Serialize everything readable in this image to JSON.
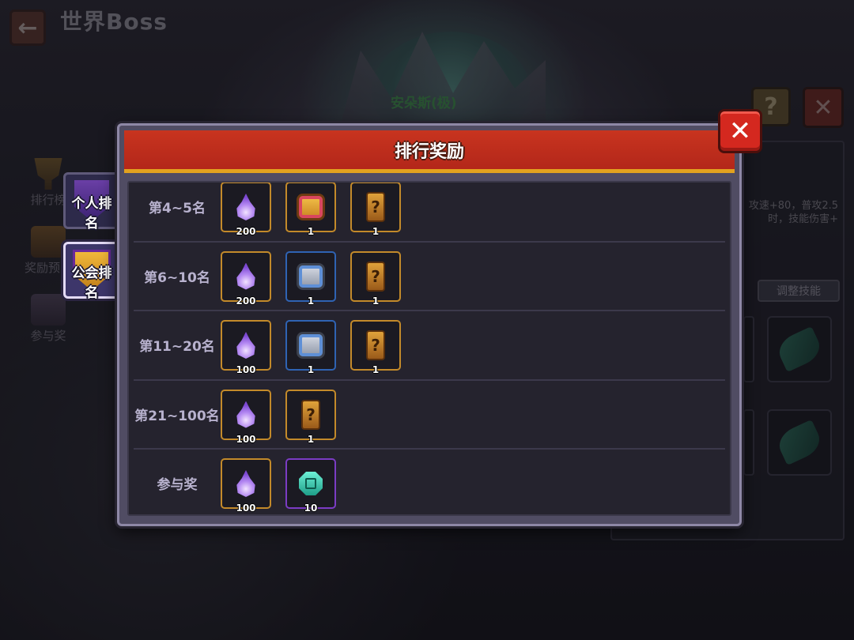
{
  "topbar": {
    "back_icon": "←",
    "title": "世界Boss"
  },
  "boss": {
    "name": "安朵斯(极)"
  },
  "top_right": {
    "help_icon": "?",
    "close_icon": "✕"
  },
  "background_sidebar": {
    "items": [
      {
        "label": "排行榜",
        "icon": "trophy-icon"
      },
      {
        "label": "奖励预览",
        "icon": "chest-icon"
      },
      {
        "label": "参与奖",
        "icon": "bag-icon"
      }
    ]
  },
  "background_panel": {
    "description": "攻速+80，普攻2.5时，技能伤害+",
    "skill_button": "调整技能"
  },
  "tabs": {
    "personal": "个人排名",
    "guild": "公会排名"
  },
  "modal": {
    "title": "排行奖励",
    "close_icon": "✕",
    "rows": [
      {
        "label": "第4~5名",
        "items": [
          {
            "icon": "purple-flame-icon",
            "count": "200",
            "rarity": "gold"
          },
          {
            "icon": "gold-chest-icon",
            "count": "1",
            "rarity": "gold"
          },
          {
            "icon": "mystery-scroll-icon",
            "count": "1",
            "rarity": "gold"
          }
        ]
      },
      {
        "label": "第6~10名",
        "items": [
          {
            "icon": "purple-flame-icon",
            "count": "200",
            "rarity": "gold"
          },
          {
            "icon": "silver-chest-icon",
            "count": "1",
            "rarity": "blue"
          },
          {
            "icon": "mystery-scroll-icon",
            "count": "1",
            "rarity": "gold"
          }
        ]
      },
      {
        "label": "第11~20名",
        "items": [
          {
            "icon": "purple-flame-icon",
            "count": "100",
            "rarity": "gold"
          },
          {
            "icon": "silver-chest-icon",
            "count": "1",
            "rarity": "blue"
          },
          {
            "icon": "mystery-scroll-icon",
            "count": "1",
            "rarity": "gold"
          }
        ]
      },
      {
        "label": "第21~100名",
        "items": [
          {
            "icon": "purple-flame-icon",
            "count": "100",
            "rarity": "gold"
          },
          {
            "icon": "mystery-scroll-icon",
            "count": "1",
            "rarity": "gold"
          }
        ]
      },
      {
        "label": "参与奖",
        "items": [
          {
            "icon": "purple-flame-icon",
            "count": "100",
            "rarity": "gold"
          },
          {
            "icon": "teal-gem-icon",
            "count": "10",
            "rarity": "purple"
          }
        ]
      }
    ]
  },
  "colors": {
    "header_red": "#c8341f",
    "header_trim": "#e2a21f",
    "frame_gold": "#c38a2a",
    "frame_blue": "#2f63b3",
    "frame_purple": "#7b3cc4",
    "row_label": "#b8b2ce"
  }
}
